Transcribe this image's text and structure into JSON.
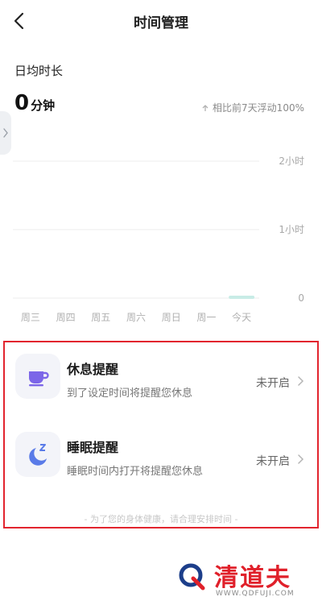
{
  "header": {
    "title": "时间管理",
    "back_icon": "chevron-left-icon"
  },
  "summary": {
    "label": "日均时长",
    "value": "0",
    "unit": "分钟",
    "compare_text": "相比前7天浮动100%",
    "compare_icon": "arrow-up-icon"
  },
  "chart_data": {
    "type": "bar",
    "categories": [
      "周三",
      "周四",
      "周五",
      "周六",
      "周日",
      "周一",
      "今天"
    ],
    "values": [
      0,
      0,
      0,
      0,
      0,
      0,
      0
    ],
    "y_tick_labels": [
      "2小时",
      "1小时",
      "0"
    ],
    "ylim": [
      0,
      2
    ],
    "grid": true,
    "highlight_color": "#c8ece6",
    "grid_color": "#ececec"
  },
  "reminders": {
    "items": [
      {
        "title": "休息提醒",
        "description": "到了设定时间将提醒您休息",
        "status": "未开启",
        "icon": "cup-icon",
        "icon_color": "#7c66e8"
      },
      {
        "title": "睡眠提醒",
        "description": "睡眠时间内打开将提醒您休息",
        "status": "未开启",
        "icon": "moon-zzz-icon",
        "icon_color": "#5a7be8"
      }
    ],
    "footer_note": "- 为了您的身体健康，请合理安排时间 -",
    "highlight_border_color": "#e2242e"
  },
  "watermark": {
    "name": "清道夫",
    "url": "WWW.QDFUJI.COM"
  }
}
